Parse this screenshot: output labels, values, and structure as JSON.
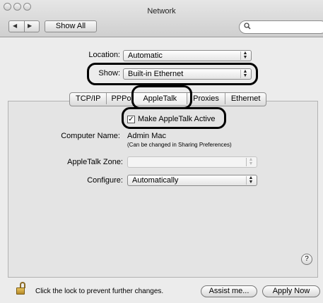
{
  "window": {
    "title": "Network"
  },
  "toolbar": {
    "show_all_label": "Show All",
    "back_glyph": "◀",
    "forward_glyph": "▶",
    "search_placeholder": "",
    "search_icon": "search-icon"
  },
  "location": {
    "label": "Location:",
    "value": "Automatic"
  },
  "show": {
    "label": "Show:",
    "value": "Built-in Ethernet"
  },
  "tabs": [
    {
      "label": "TCP/IP"
    },
    {
      "label": "PPPoE"
    },
    {
      "label": "AppleTalk",
      "selected": true
    },
    {
      "label": "Proxies"
    },
    {
      "label": "Ethernet"
    }
  ],
  "appletalk": {
    "active_label": "Make AppleTalk Active",
    "active_checked": true,
    "computer_name_label": "Computer Name:",
    "computer_name_value": "Admin Mac",
    "computer_name_hint": "(Can be changed in Sharing Preferences)",
    "zone_label": "AppleTalk Zone:",
    "zone_value": "",
    "configure_label": "Configure:",
    "configure_value": "Automatically"
  },
  "help": {
    "glyph": "?"
  },
  "footer": {
    "lock_text": "Click the lock to prevent further changes.",
    "assist_label": "Assist me...",
    "apply_label": "Apply Now"
  },
  "colors": {
    "highlight": "#000000",
    "panel": "#e4e4e4"
  }
}
